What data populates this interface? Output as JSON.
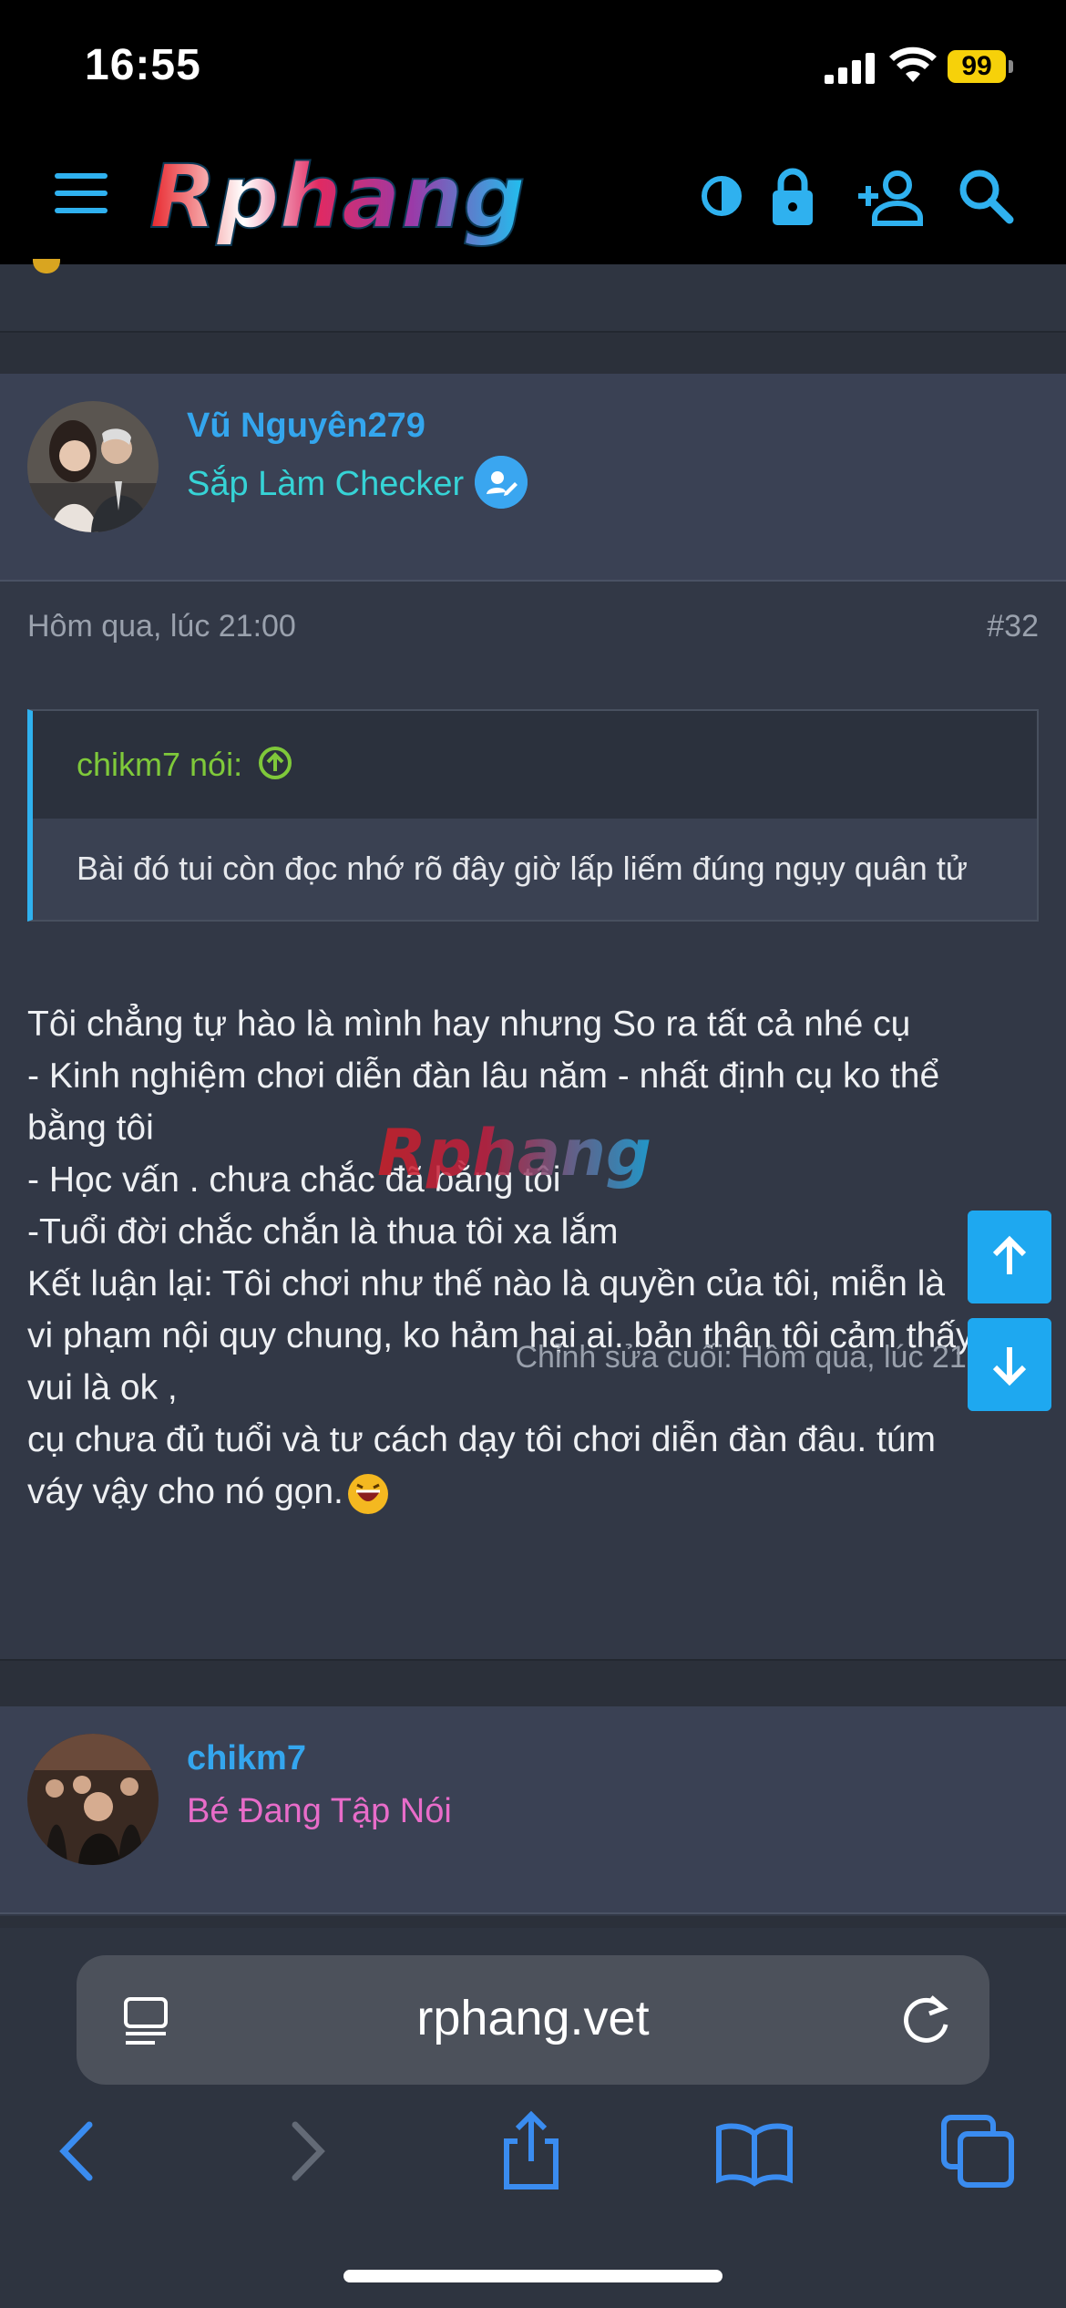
{
  "status_bar": {
    "time": "16:55",
    "battery": "99"
  },
  "header": {
    "logo_text": "Rphang",
    "icons": [
      "menu-icon",
      "theme-toggle-icon",
      "lock-icon",
      "add-user-icon",
      "search-icon"
    ]
  },
  "posts": [
    {
      "username": "Vũ Nguyên279",
      "user_title": "Sắp Làm Checker",
      "date": "Hôm qua, lúc 21:00",
      "number": "#32",
      "quote": {
        "author": "chikm7 nói:",
        "text": "Bài đó tui còn đọc nhớ rõ đây giờ lấp liếm đúng ngụy quân tử"
      },
      "body_lines": [
        "Tôi chẳng tự hào là mình hay nhưng So ra tất cả nhé cụ",
        "- Kinh nghiệm chơi diễn đàn lâu năm - nhất định cụ ko thể",
        "bằng tôi",
        "- Học vấn . chưa chắc đã bằng tôi",
        "-Tuổi đời chắc chắn là thua tôi xa lắm",
        "Kết luận lại: Tôi chơi như thế nào là quyền của tôi, miễn là",
        "vi phạm nội quy chung, ko hảm hại ai. bản thân tôi cảm thấy",
        "vui là ok ,",
        "cụ chưa đủ tuổi và tư cách dạy tôi chơi diễn đàn đâu. túm",
        "váy vậy cho nó gọn."
      ],
      "edited": "Chỉnh sửa cuối: Hôm qua, lúc 21:16"
    },
    {
      "username": "chikm7",
      "user_title": "Bé Đang Tập Nói"
    }
  ],
  "browser": {
    "url": "rphang.vet"
  },
  "colors": {
    "accent": "#2fb1ef",
    "quote_author": "#7fc93a",
    "title_teal": "#36d3d6",
    "title_pink": "#e86cc9"
  }
}
